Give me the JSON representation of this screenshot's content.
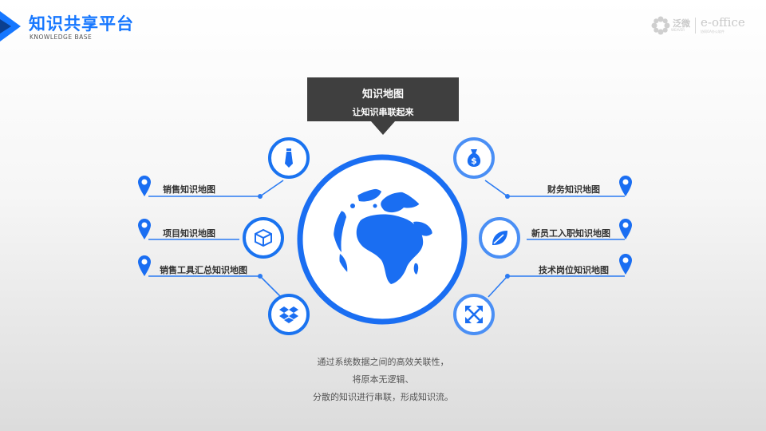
{
  "header": {
    "title": "知识共享平台",
    "subtitle": "KNOWLEDGE  BASE"
  },
  "logo": {
    "brand_cn": "泛微",
    "brand_cn_sub": "WEAVER",
    "brand_en": "e-office",
    "brand_en_sub": "协同OA办公软件"
  },
  "callout": {
    "title": "知识地图",
    "subtitle": "让知识串联起来"
  },
  "left_items": [
    {
      "label": "销售知识地图",
      "icon": "tie-icon"
    },
    {
      "label": "项目知识地图",
      "icon": "cube-icon"
    },
    {
      "label": "销售工具汇总知识地图",
      "icon": "dropbox-icon"
    }
  ],
  "right_items": [
    {
      "label": "财务知识地图",
      "icon": "money-bag-icon"
    },
    {
      "label": "新员工入职知识地图",
      "icon": "leaf-icon"
    },
    {
      "label": "技术岗位知识地图",
      "icon": "expand-arrows-icon"
    }
  ],
  "description": [
    "通过系统数据之间的高效关联性，",
    "将原本无逻辑、",
    "分散的知识进行串联，形成知识流。"
  ],
  "colors": {
    "primary": "#1677ff",
    "ring": "#1a73f0",
    "dark": "#3f3f3f"
  }
}
